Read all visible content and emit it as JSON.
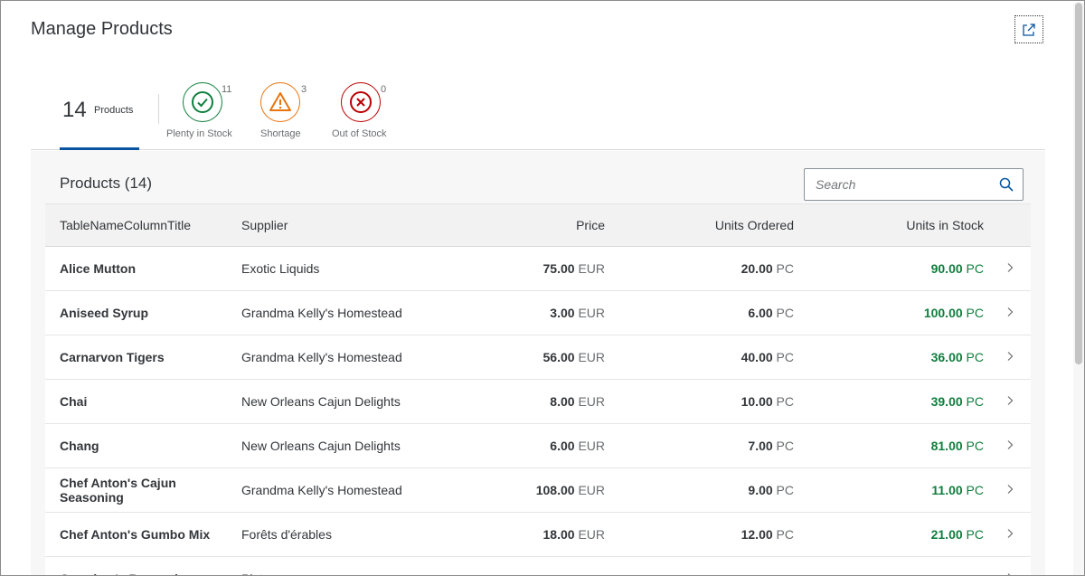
{
  "header": {
    "title": "Manage Products",
    "share_icon": "share-icon"
  },
  "tabs": {
    "all": {
      "count": "14",
      "label": "Products"
    },
    "items": [
      {
        "key": "plenty",
        "label": "Plenty in Stock",
        "badge": "11",
        "icon": "check-circle-icon",
        "color": "#107e3e"
      },
      {
        "key": "shortage",
        "label": "Shortage",
        "badge": "3",
        "icon": "warning-icon",
        "color": "#e9730c"
      },
      {
        "key": "out",
        "label": "Out of Stock",
        "badge": "0",
        "icon": "error-circle-icon",
        "color": "#bb0000"
      }
    ]
  },
  "table": {
    "title": "Products (14)",
    "search_placeholder": "Search",
    "columns": [
      "TableNameColumnTitle",
      "Supplier",
      "Price",
      "Units Ordered",
      "Units in Stock"
    ],
    "rows": [
      {
        "name": "Alice Mutton",
        "supplier": "Exotic Liquids",
        "price": "75.00",
        "price_unit": "EUR",
        "ordered": "20.00",
        "ordered_unit": "PC",
        "stock": "90.00",
        "stock_unit": "PC"
      },
      {
        "name": "Aniseed Syrup",
        "supplier": "Grandma Kelly's Homestead",
        "price": "3.00",
        "price_unit": "EUR",
        "ordered": "6.00",
        "ordered_unit": "PC",
        "stock": "100.00",
        "stock_unit": "PC"
      },
      {
        "name": "Carnarvon Tigers",
        "supplier": "Grandma Kelly's Homestead",
        "price": "56.00",
        "price_unit": "EUR",
        "ordered": "40.00",
        "ordered_unit": "PC",
        "stock": "36.00",
        "stock_unit": "PC"
      },
      {
        "name": "Chai",
        "supplier": "New Orleans Cajun Delights",
        "price": "8.00",
        "price_unit": "EUR",
        "ordered": "10.00",
        "ordered_unit": "PC",
        "stock": "39.00",
        "stock_unit": "PC"
      },
      {
        "name": "Chang",
        "supplier": "New Orleans Cajun Delights",
        "price": "6.00",
        "price_unit": "EUR",
        "ordered": "7.00",
        "ordered_unit": "PC",
        "stock": "81.00",
        "stock_unit": "PC"
      },
      {
        "name": "Chef Anton's Cajun Seasoning",
        "supplier": "Grandma Kelly's Homestead",
        "price": "108.00",
        "price_unit": "EUR",
        "ordered": "9.00",
        "ordered_unit": "PC",
        "stock": "11.00",
        "stock_unit": "PC"
      },
      {
        "name": "Chef Anton's Gumbo Mix",
        "supplier": "Forêts d'érables",
        "price": "18.00",
        "price_unit": "EUR",
        "ordered": "12.00",
        "ordered_unit": "PC",
        "stock": "21.00",
        "stock_unit": "PC"
      },
      {
        "name": "Grandma's Boysenberry",
        "supplier": "Plutzer",
        "price": "",
        "price_unit": "",
        "ordered": "",
        "ordered_unit": "",
        "stock": "",
        "stock_unit": ""
      }
    ]
  },
  "colors": {
    "accent": "#0854a0",
    "positive": "#107e3e"
  }
}
